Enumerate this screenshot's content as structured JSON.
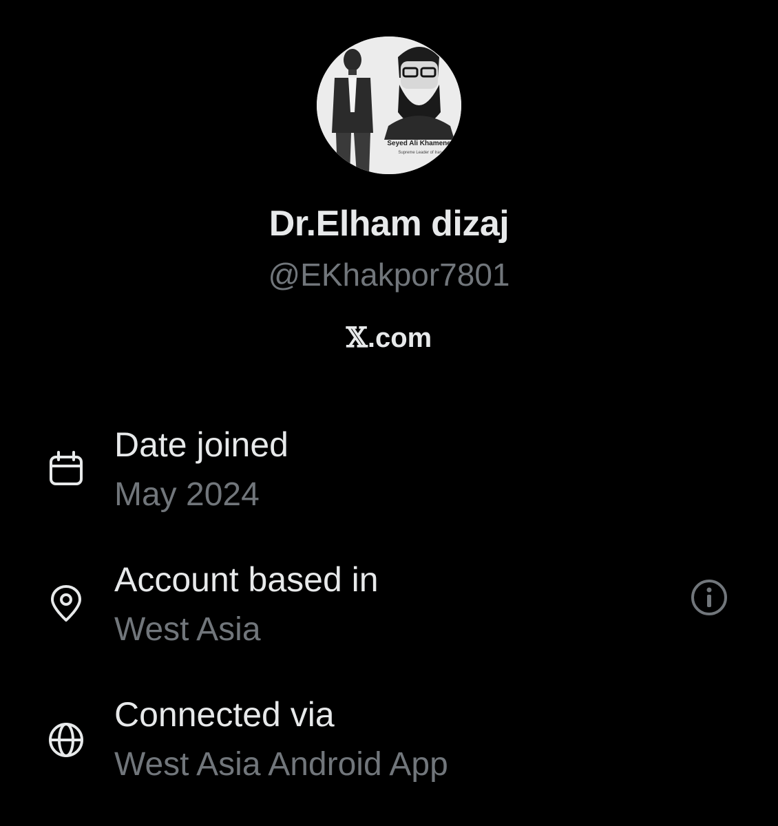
{
  "profile": {
    "avatar_caption_name": "Seyed Ali Khamenei",
    "avatar_caption_title": "Supreme Leader of Iran",
    "display_name": "Dr.Elham dizaj",
    "handle": "@EKhakpor7801",
    "site_logo": "𝕏",
    "site_suffix": ".com"
  },
  "details": [
    {
      "icon": "calendar-icon",
      "label": "Date joined",
      "value": "May 2024"
    },
    {
      "icon": "location-pin-icon",
      "label": "Account based in",
      "value": "West Asia",
      "action_icon": "info-icon"
    },
    {
      "icon": "globe-icon",
      "label": "Connected via",
      "value": "West Asia Android App"
    }
  ],
  "colors": {
    "background": "#000000",
    "primary_text": "#e7e9ea",
    "secondary_text": "#71767b"
  }
}
